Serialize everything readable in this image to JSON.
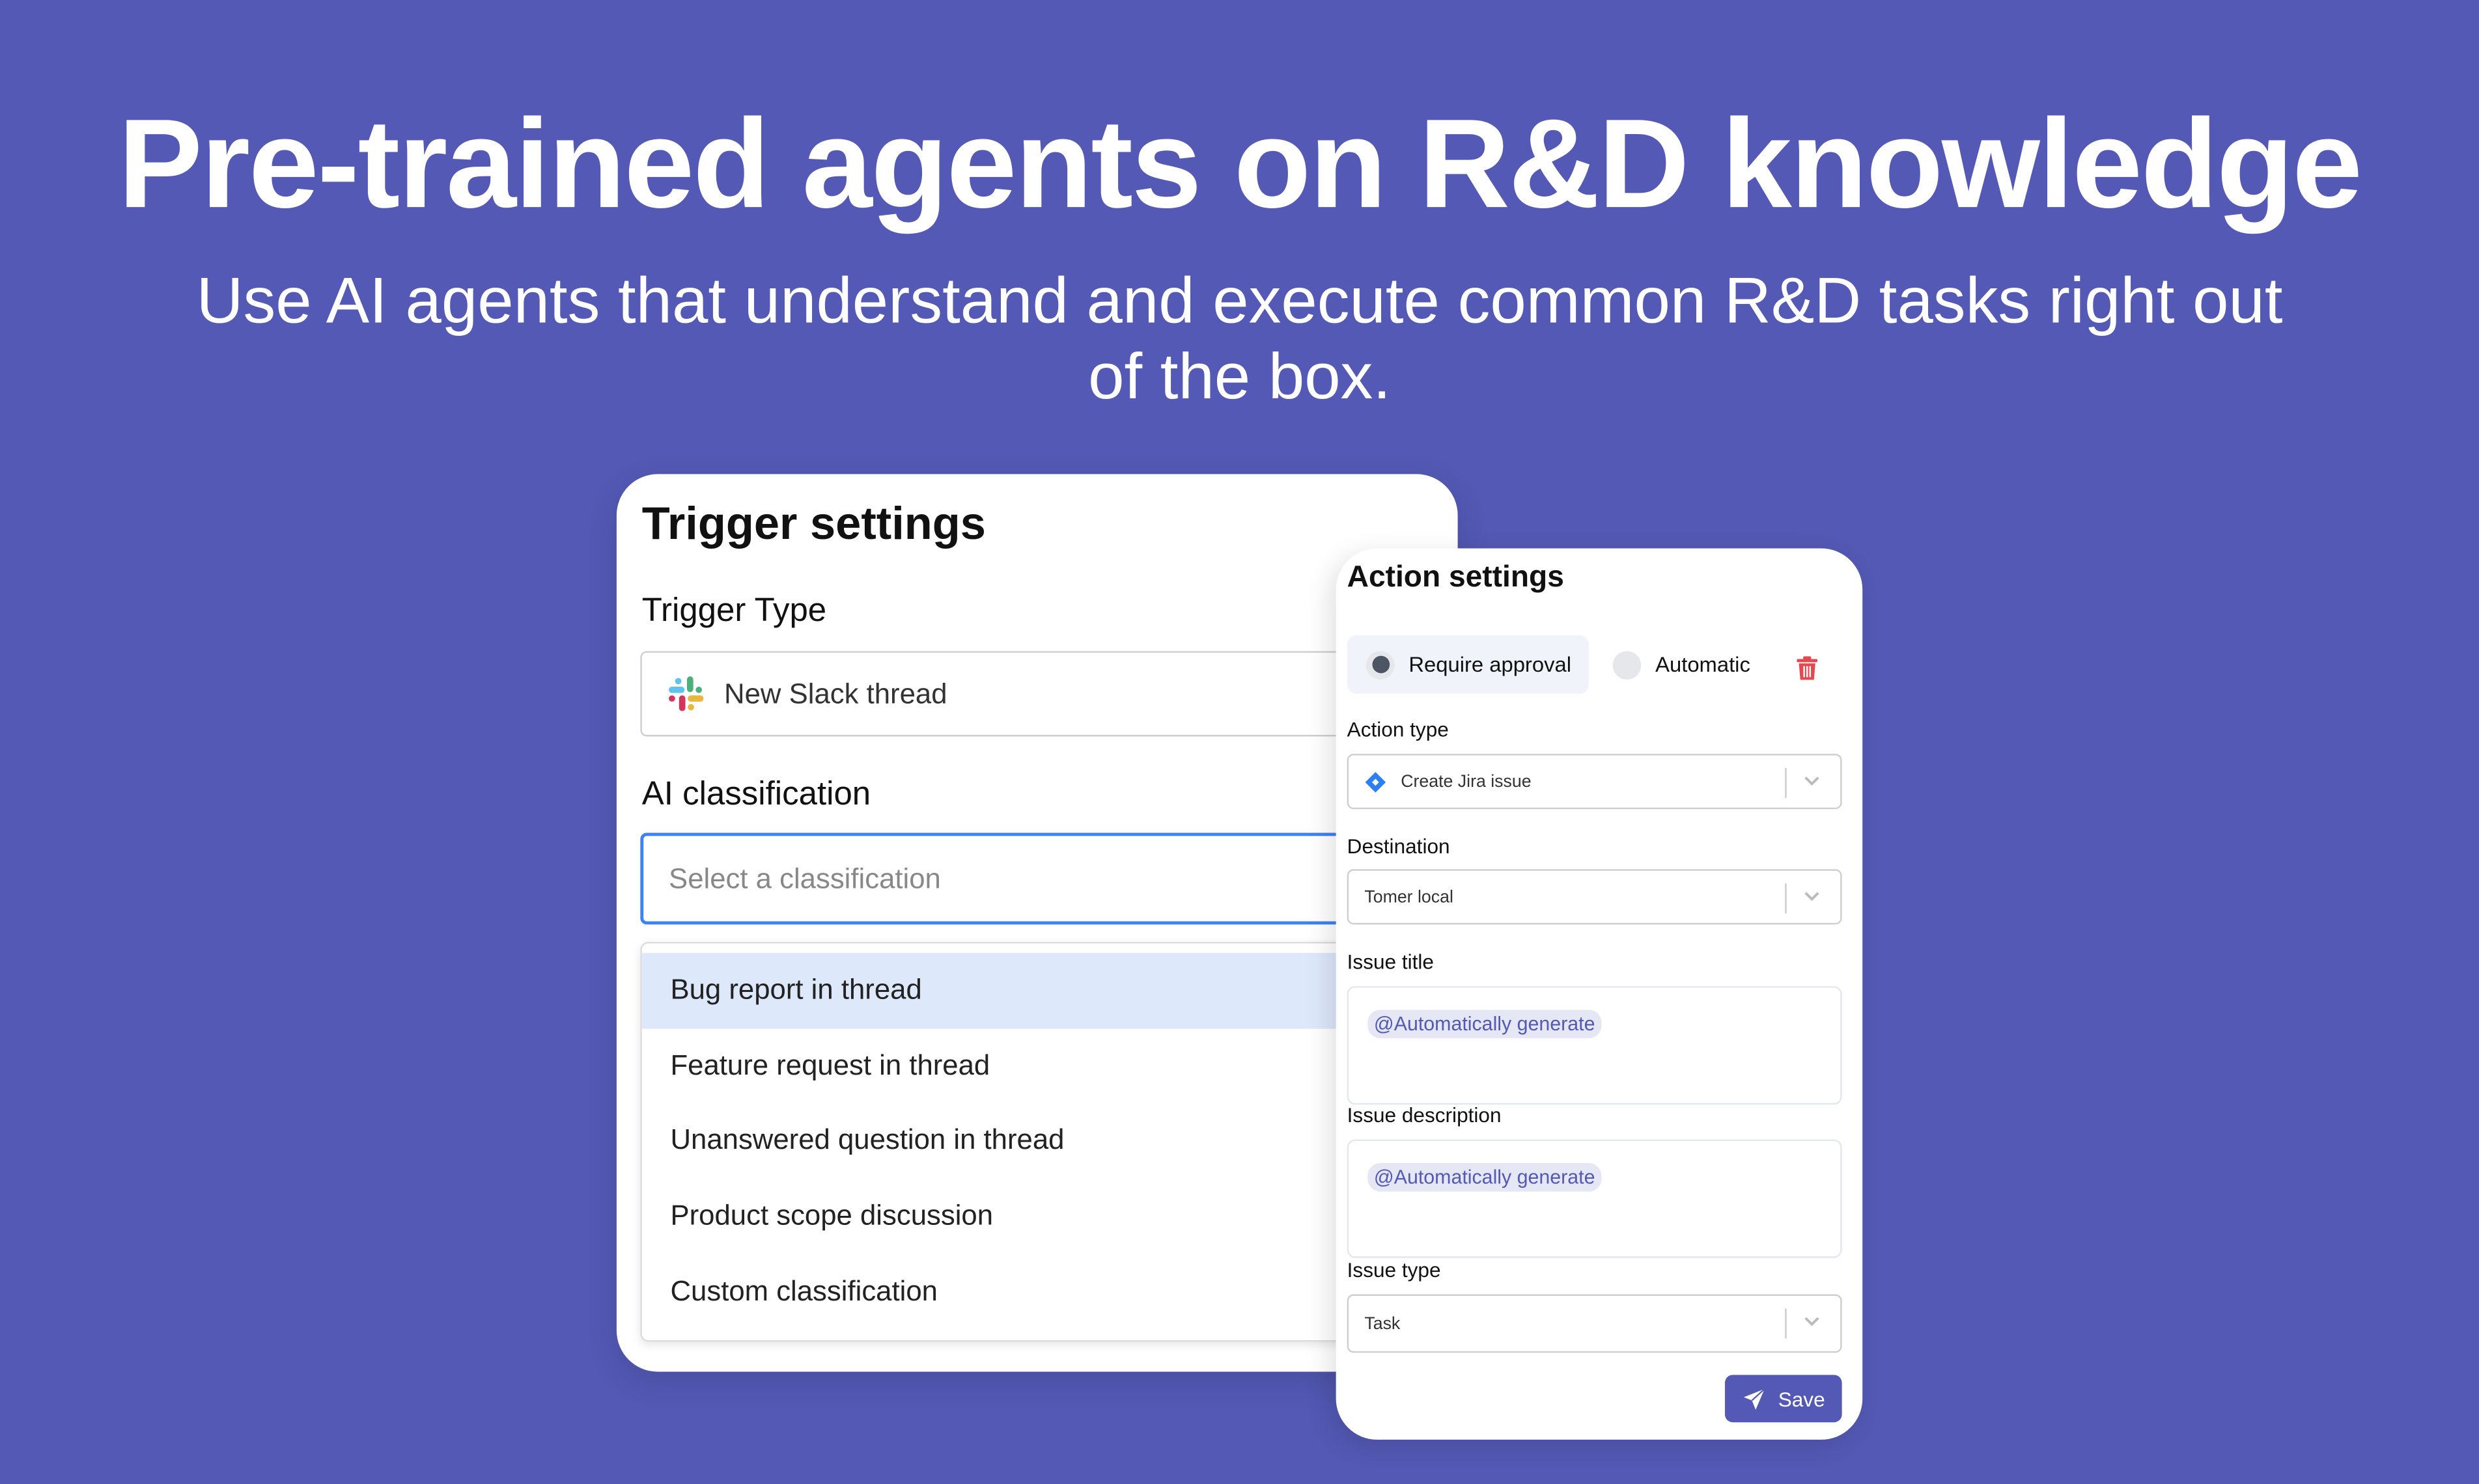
{
  "hero": {
    "title": "Pre-trained agents on R&D knowledge",
    "subtitle": "Use AI agents that understand and execute common R&D tasks right out of the box."
  },
  "trigger_settings": {
    "title": "Trigger settings",
    "trigger_type_label": "Trigger Type",
    "trigger_type_value": "New Slack thread",
    "trigger_type_icon": "slack-icon",
    "classification_label": "AI classification",
    "classification_placeholder": "Select a classification",
    "classification_options": [
      "Bug report in thread",
      "Feature request in thread",
      "Unanswered question in thread",
      "Product scope discussion",
      "Custom classification"
    ],
    "highlighted_option_index": 0
  },
  "action_settings": {
    "title": "Action settings",
    "modes": [
      {
        "label": "Require approval",
        "selected": true
      },
      {
        "label": "Automatic",
        "selected": false
      }
    ],
    "delete_icon": "trash-icon",
    "action_type_label": "Action type",
    "action_type_value": "Create Jira issue",
    "action_type_icon": "jira-icon",
    "destination_label": "Destination",
    "destination_value": "Tomer local",
    "issue_title_label": "Issue title",
    "issue_title_chip": "@Automatically generate",
    "issue_description_label": "Issue description",
    "issue_description_chip": "@Automatically generate",
    "issue_type_label": "Issue type",
    "issue_type_value": "Task",
    "save_label": "Save"
  },
  "colors": {
    "background": "#5359b4",
    "accent": "#5359b4",
    "focus_blue": "#3b82f6",
    "highlight": "#dde8fb",
    "delete_red": "#e5484d"
  }
}
